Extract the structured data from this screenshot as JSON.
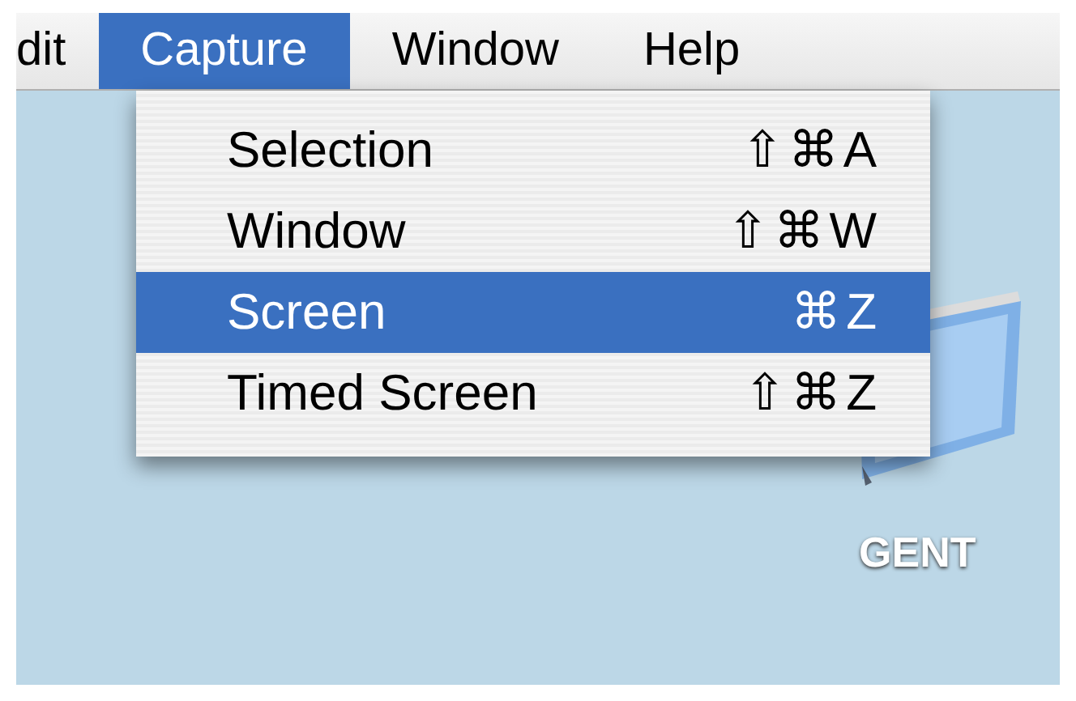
{
  "menu_bar": [
    {
      "label": "dit",
      "selected": false
    },
    {
      "label": "Capture",
      "selected": true
    },
    {
      "label": "Window",
      "selected": false
    },
    {
      "label": "Help",
      "selected": false
    }
  ],
  "menu": {
    "items": [
      {
        "label": "Selection",
        "shortcut": "⇧⌘A",
        "selected": false
      },
      {
        "label": "Window",
        "shortcut": "⇧⌘W",
        "selected": false
      },
      {
        "label": "Screen",
        "shortcut": "⌘Z",
        "selected": true
      },
      {
        "label": "Timed Screen",
        "shortcut": "⇧⌘Z",
        "selected": false
      }
    ]
  },
  "desktop": {
    "icons": [
      {
        "label": "GENT"
      }
    ]
  }
}
